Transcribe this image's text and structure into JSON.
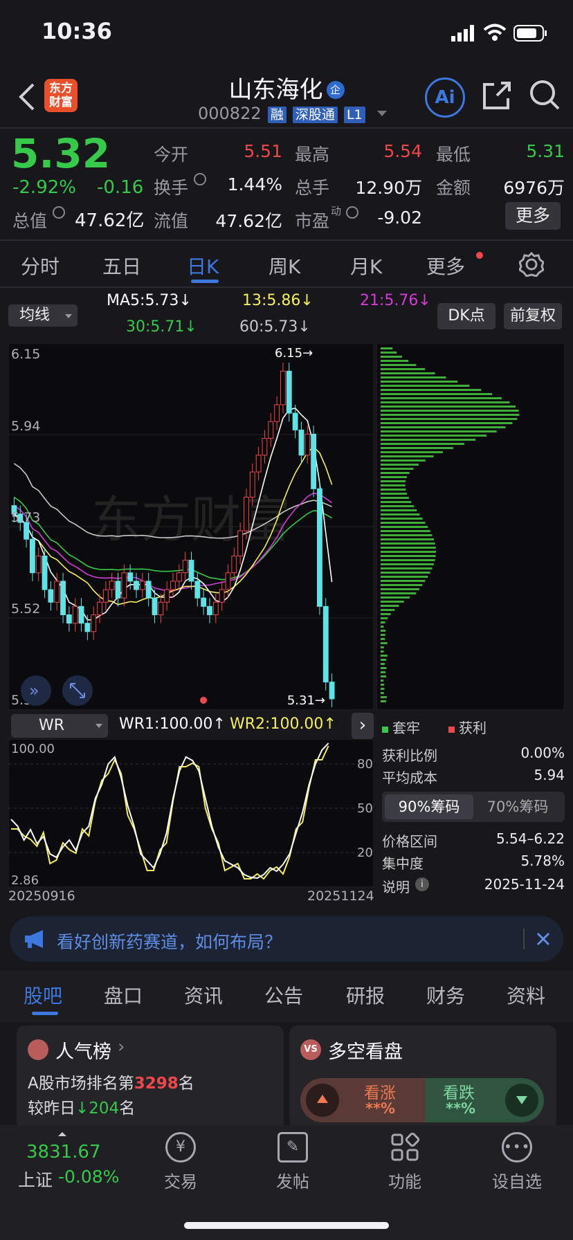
{
  "status_bar": {
    "time": "10:36"
  },
  "header": {
    "title": "山东海化",
    "title_badge": "企",
    "code": "000822",
    "tags": [
      "融",
      "深股通",
      "L1"
    ],
    "ai_label": "Ai"
  },
  "quote": {
    "price": "5.32",
    "change_pct": "-2.92%",
    "change": "-0.16",
    "total_value_label": "总值",
    "total_value": "47.62亿",
    "fields": [
      {
        "label": "今开",
        "value": "5.51"
      },
      {
        "label": "最高",
        "value": "5.54"
      },
      {
        "label": "最低",
        "value": "5.31"
      },
      {
        "label": "换手",
        "value": "1.44%"
      },
      {
        "label": "总手",
        "value": "12.90万"
      },
      {
        "label": "金额",
        "value": "6976万"
      },
      {
        "label": "流值",
        "value": "47.62亿"
      },
      {
        "label": "市盈",
        "sup": "动",
        "value": "-9.02"
      }
    ],
    "more_button": "更多"
  },
  "period_tabs": [
    "分时",
    "五日",
    "日K",
    "周K",
    "月K",
    "更多"
  ],
  "active_period": "日K",
  "indicator": {
    "selector": "均线",
    "ma5": "MA5:5.73",
    "ma13": "13:5.86",
    "ma21": "21:5.76",
    "ma30": "30:5.71",
    "ma60": "60:5.73",
    "dk_button": "DK点",
    "adjust_button": "前复权"
  },
  "kline": {
    "price_labels": [
      "6.15",
      "5.94",
      "5.73",
      "5.52",
      "5.31"
    ],
    "high_marker": "6.15",
    "low_marker": "5.31",
    "watermark": "东方财富",
    "colors": {
      "up": "#f0474a",
      "down": "#5fe3e6",
      "ma5": "#ffffff",
      "ma13": "#f5ef60",
      "ma21": "#d23cd6",
      "ma30": "#36c94a",
      "ma60": "#c8c8c8"
    }
  },
  "wr": {
    "selector": "WR",
    "wr1": "WR1:100.00",
    "wr2": "WR2:100.00",
    "top_label": "100.00",
    "bottom_label": "2.86",
    "levels": [
      "80",
      "50",
      "20"
    ],
    "date_start": "20250916",
    "date_end": "20251124"
  },
  "chips": {
    "legend_trapped": "套牢",
    "legend_profit": "获利",
    "profit_ratio_label": "获利比例",
    "profit_ratio": "0.00%",
    "avg_cost_label": "平均成本",
    "avg_cost": "5.94",
    "tab_90": "90%筹码",
    "tab_70": "70%筹码",
    "range_label": "价格区间",
    "range": "5.54–6.22",
    "concentration_label": "集中度",
    "concentration": "5.78%",
    "note_label": "说明",
    "date": "2025-11-24"
  },
  "banner": {
    "text": "看好创新药赛道，如何布局？"
  },
  "section_tabs": [
    "股吧",
    "盘口",
    "资讯",
    "公告",
    "研报",
    "财务",
    "资料"
  ],
  "active_section": "股吧",
  "cards": {
    "popularity": {
      "title": "人气榜",
      "rank_prefix": "A股市场排名第",
      "rank": "3298",
      "rank_suffix": "名",
      "compare_prefix": "较昨日",
      "compare_value": "204",
      "compare_suffix": "名"
    },
    "sentiment": {
      "title": "多空看盘",
      "bull": "看涨",
      "bull_value": "**%",
      "bear": "看跌",
      "bear_value": "**%"
    }
  },
  "bottom_nav": {
    "index_value": "3831.67",
    "index_name": "上证",
    "index_change": "-0.08%",
    "items": [
      "交易",
      "发帖",
      "功能",
      "设自选"
    ]
  }
}
